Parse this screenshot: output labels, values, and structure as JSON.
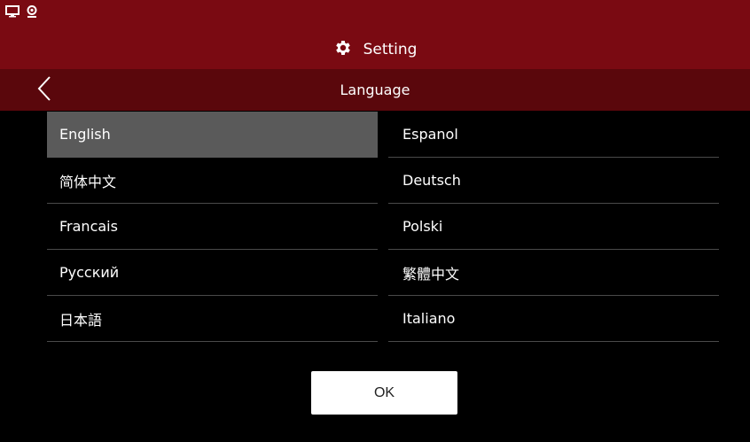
{
  "status_bar": {
    "icons": [
      "monitor-icon",
      "camera-icon"
    ]
  },
  "header": {
    "title": "Setting",
    "icon": "gear-icon"
  },
  "subheader": {
    "title": "Language",
    "back_icon": "chevron-left-icon"
  },
  "languages": {
    "left": [
      {
        "label": "English",
        "selected": true
      },
      {
        "label": "简体中文",
        "selected": false
      },
      {
        "label": "Francais",
        "selected": false
      },
      {
        "label": "Русский",
        "selected": false
      },
      {
        "label": "日本語",
        "selected": false
      }
    ],
    "right": [
      {
        "label": "Espanol",
        "selected": false
      },
      {
        "label": "Deutsch",
        "selected": false
      },
      {
        "label": "Polski",
        "selected": false
      },
      {
        "label": "繁體中文",
        "selected": false
      },
      {
        "label": "Italiano",
        "selected": false
      }
    ]
  },
  "ok_button": {
    "label": "OK"
  },
  "colors": {
    "header_bg": "#7a0a12",
    "subheader_bg": "#5a070c",
    "selected_bg": "#5a5a5a",
    "background": "#000000"
  }
}
